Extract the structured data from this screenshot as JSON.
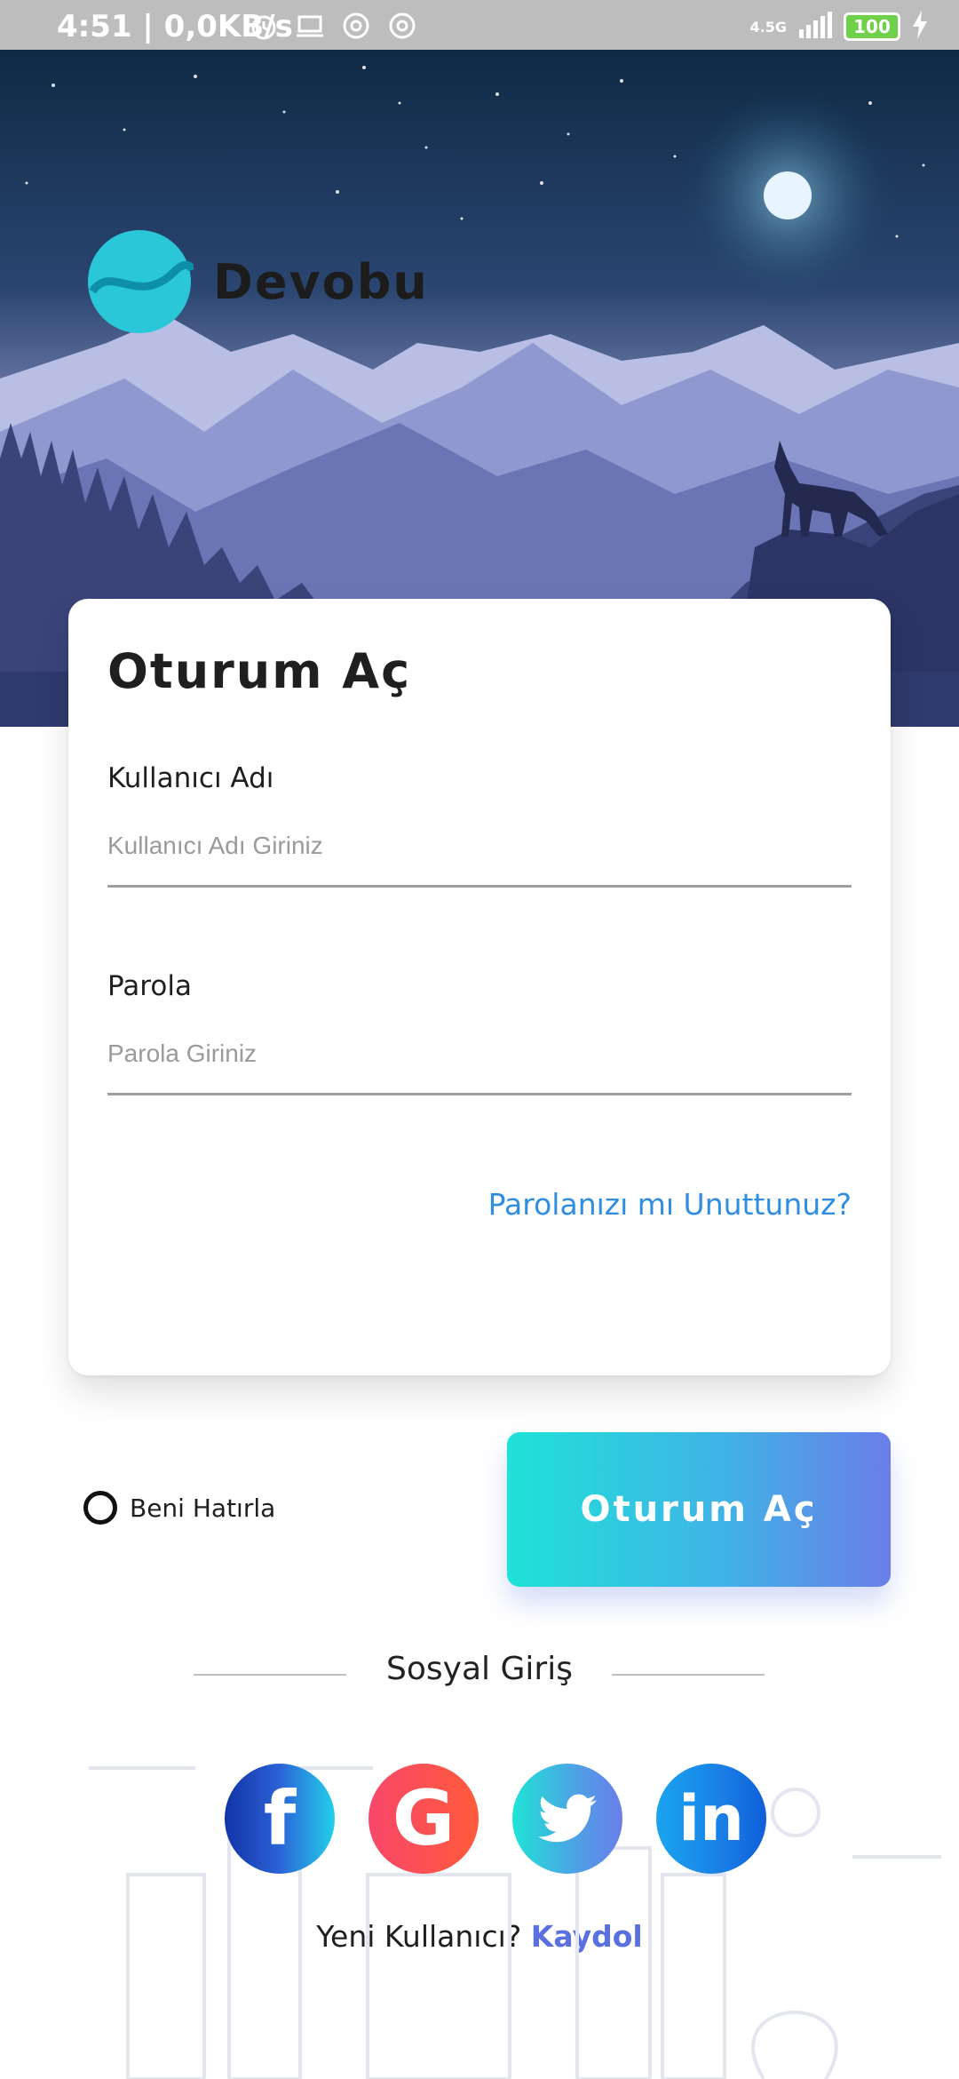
{
  "status_bar": {
    "time": "4:51",
    "net_speed": "| 0,0KB/s",
    "network_type": "4.5G",
    "battery": "100"
  },
  "brand": {
    "name": "Devobu"
  },
  "login_card": {
    "title": "Oturum Aç",
    "username": {
      "label": "Kullanıcı Adı",
      "placeholder": "Kullanıcı Adı Giriniz",
      "value": ""
    },
    "password": {
      "label": "Parola",
      "placeholder": "Parola Giriniz",
      "value": ""
    },
    "forgot_link": "Parolanızı mı Unuttunuz?"
  },
  "remember_me": {
    "label": "Beni Hatırla",
    "checked": false
  },
  "login_button": {
    "label": "Oturum Aç"
  },
  "social": {
    "title": "Sosyal Giriş",
    "providers": [
      "facebook",
      "google",
      "twitter",
      "linkedin"
    ]
  },
  "signup": {
    "prompt": "Yeni Kullanıcı?",
    "link": "Kaydol"
  },
  "colors": {
    "accent_blue": "#2f8ee0",
    "signup_link": "#5a6fe0",
    "button_start": "#1fe2d8",
    "button_end": "#6a7ee8"
  }
}
